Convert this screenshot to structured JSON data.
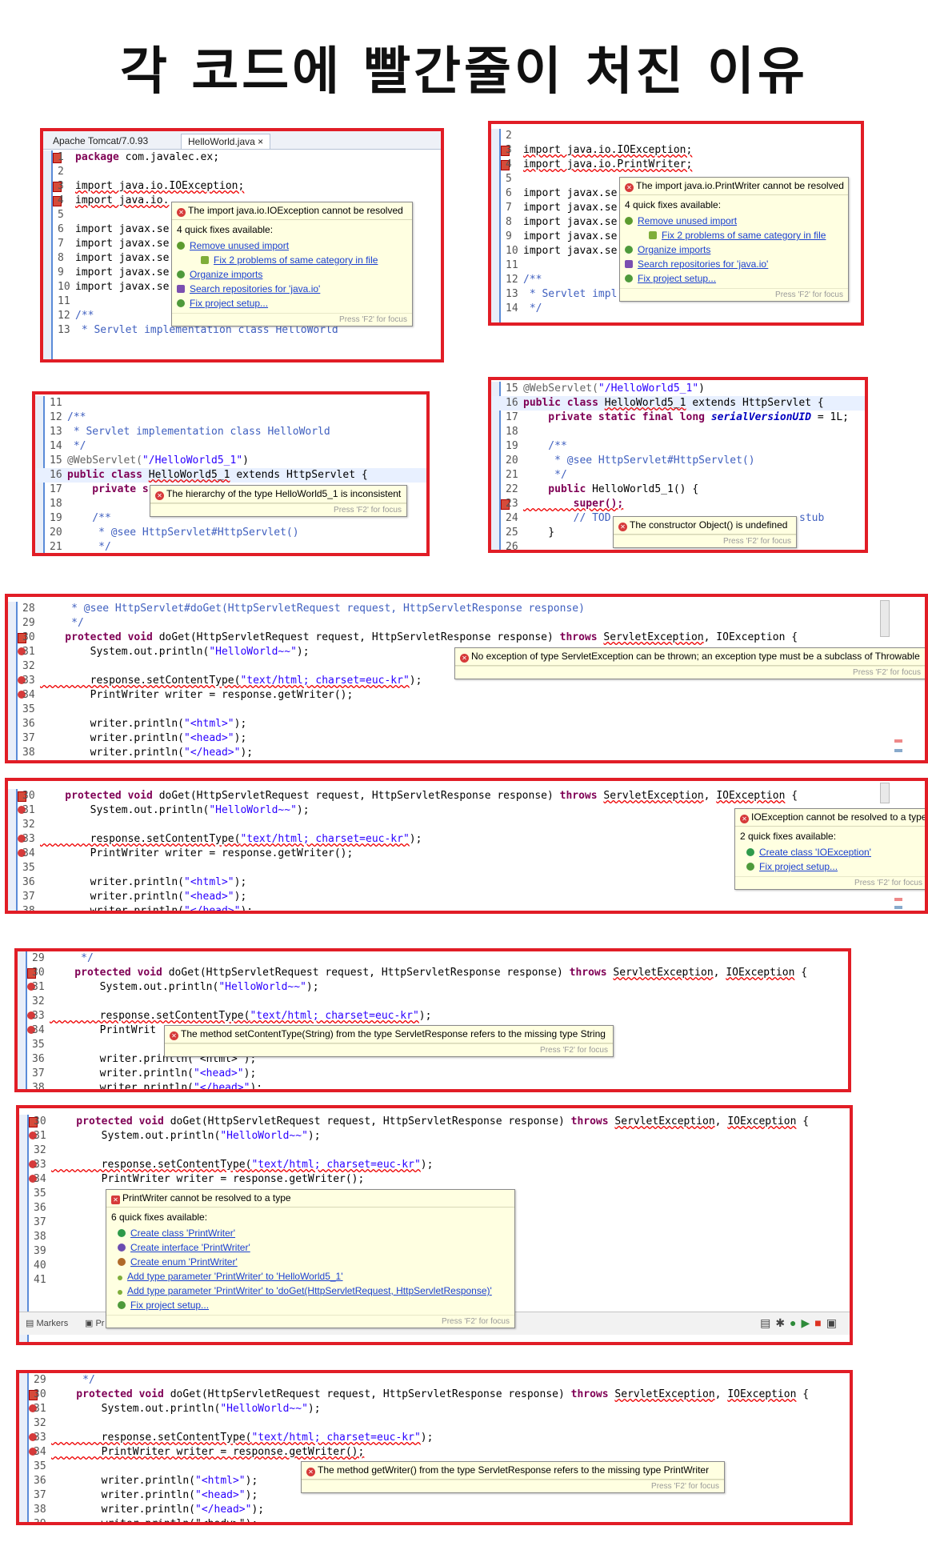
{
  "title": "각 코드에 빨간줄이 처진 이유",
  "colors": {
    "frame": "#e11d26",
    "keyword": "#7f0055",
    "string": "#2a00ff",
    "comment": "#3f5fbf",
    "link": "#1a3fd1",
    "tooltip_bg": "#ffffe1"
  },
  "p1": {
    "tabs": [
      "Apache Tomcat/7.0.93",
      "HelloWorld.java"
    ],
    "lines": {
      "l1n": "1",
      "l1": "package com.javalec.ex;",
      "l2n": "2",
      "l3n": "3",
      "l3": "import java.io.IOException;",
      "l4n": "4",
      "l4": "import java.io.",
      "l5n": "5",
      "l6n": "6",
      "l6": "import javax.se",
      "l7n": "7",
      "l7": "import javax.se",
      "l8n": "8",
      "l8": "import javax.se",
      "l9n": "9",
      "l9": "import javax.se",
      "l10n": "10",
      "l10": "import javax.se",
      "l11n": "11",
      "l12n": "12",
      "l12": "/**",
      "l13n": "13",
      "l13": " * Servlet implementation class HelloWorld"
    },
    "hover": {
      "message": "The import java.io.IOException cannot be resolved",
      "sub": "4 quick fixes available:",
      "fixes": [
        "Remove unused import",
        "Fix 2 problems of same category in file",
        "Organize imports",
        "Search repositories for 'java.io'",
        "Fix project setup..."
      ],
      "foot": "Press 'F2' for focus"
    }
  },
  "p2": {
    "lines": {
      "l2n": "2",
      "l3n": "3",
      "l3": "import java.io.IOException;",
      "l4n": "4",
      "l4": "import java.io.PrintWriter;",
      "l5n": "5",
      "l6n": "6",
      "l6": "import javax.se",
      "l7n": "7",
      "l7": "import javax.se",
      "l8n": "8",
      "l8": "import javax.se",
      "l9n": "9",
      "l9": "import javax.se",
      "l10n": "10",
      "l10": "import javax.se",
      "l11n": "11",
      "l12n": "12",
      "l12": "/**",
      "l13n": "13",
      "l13": " * Servlet impl",
      "l14n": "14",
      "l14": " */"
    },
    "hover": {
      "message": "The import java.io.PrintWriter cannot be resolved",
      "sub": "4 quick fixes available:",
      "fixes": [
        "Remove unused import",
        "Fix 2 problems of same category in file",
        "Organize imports",
        "Search repositories for 'java.io'",
        "Fix project setup..."
      ],
      "foot": "Press 'F2' for focus"
    }
  },
  "p3": {
    "lines": {
      "l11n": "11",
      "l12n": "12",
      "l12": "/**",
      "l13n": "13",
      "l13": " * Servlet implementation class HelloWorld",
      "l14n": "14",
      "l14": " */",
      "l15n": "15",
      "l15a": "@WebServlet(",
      "l15b": "\"/HelloWorld5_1\"",
      "l15c": ")",
      "l16n": "16",
      "l16a": "public class ",
      "l16b": "HelloWorld5_1",
      "l16c": " extends HttpServlet {",
      "l17n": "17",
      "l17": "    private s",
      "l18n": "18",
      "l19n": "19",
      "l19": "    /**",
      "l20n": "20",
      "l20": "     * @see HttpServlet#HttpServlet()",
      "l21n": "21",
      "l21": "     */"
    },
    "hover": {
      "message": "The hierarchy of the type HelloWorld5_1 is inconsistent",
      "foot": "Press 'F2' for focus"
    }
  },
  "p4": {
    "lines": {
      "l15n": "15",
      "l15a": "@WebServlet(",
      "l15b": "\"/HelloWorld5_1\"",
      "l15c": ")",
      "l16n": "16",
      "l16a": "public class ",
      "l16b": "HelloWorld5_1",
      "l16c": " extends HttpServlet {",
      "l17n": "17",
      "l17a": "    private static final long ",
      "l17b": "serialVersionUID",
      "l17c": " = 1L;",
      "l18n": "18",
      "l19n": "19",
      "l19": "    /**",
      "l20n": "20",
      "l20": "     * @see HttpServlet#HttpServlet()",
      "l21n": "21",
      "l21": "     */",
      "l22n": "22",
      "l22a": "    public ",
      "l22b": "HelloWorld5_1() {",
      "l23n": "23",
      "l23": "        super();",
      "l24n": "24",
      "l24": "        // TOD",
      "l24b": "stub",
      "l25n": "25",
      "l25": "    }",
      "l26n": "26"
    },
    "hover": {
      "message": "The constructor Object() is undefined",
      "foot": "Press 'F2' for focus"
    }
  },
  "p5": {
    "lines": {
      "l28n": "28",
      "l28": "     * @see HttpServlet#doGet(HttpServletRequest request, HttpServletResponse response)",
      "l29n": "29",
      "l29": "     */",
      "l30n": "30",
      "l30a": "    protected void ",
      "l30b": "doGet(HttpServletRequest request, HttpServletResponse response) ",
      "l30c": "throws ",
      "l30d": "ServletException",
      "l30e": ", IOException {",
      "l31n": "31",
      "l31a": "        System.out.println(",
      "l31b": "\"HelloWorld~~\"",
      "l31c": ");",
      "l32n": "32",
      "l33n": "33",
      "l33a": "        response.setContentType(",
      "l33b": "\"text/html; charset=euc-kr\"",
      "l33c": ");",
      "l34n": "34",
      "l34": "        PrintWriter writer = response.getWriter();",
      "l35n": "35",
      "l36n": "36",
      "l36a": "        writer.println(",
      "l36b": "\"<html>\"",
      "l36c": ");",
      "l37n": "37",
      "l37a": "        writer.println(",
      "l37b": "\"<head>\"",
      "l37c": ");",
      "l38n": "38",
      "l38a": "        writer.println(",
      "l38b": "\"</head>\"",
      "l38c": ");"
    },
    "hover": {
      "message": "No exception of type ServletException can be thrown; an exception type must be a subclass of Throwable",
      "foot": "Press 'F2' for focus"
    }
  },
  "p6": {
    "lines": {
      "l30n": "30",
      "l30a": "    protected void ",
      "l30b": "doGet(HttpServletRequest request, HttpServletResponse response) ",
      "l30c": "throws ",
      "l30d": "ServletException",
      "l30e": ", ",
      "l30f": "IOException",
      "l30g": " {",
      "l31n": "31",
      "l31a": "        System.out.println(",
      "l31b": "\"HelloWorld~~\"",
      "l31c": ");",
      "l32n": "32",
      "l33n": "33",
      "l33a": "        response.setContentType(",
      "l33b": "\"text/html; charset=euc-kr\"",
      "l33c": ");",
      "l34n": "34",
      "l34": "        PrintWriter writer = response.getWriter();",
      "l35n": "35",
      "l36n": "36",
      "l36a": "        writer.println(",
      "l36b": "\"<html>\"",
      "l36c": ");",
      "l37n": "37",
      "l37a": "        writer.println(",
      "l37b": "\"<head>\"",
      "l37c": ");",
      "l38n": "38",
      "l38a": "        writer.println(",
      "l38b": "\"</head>\"",
      "l38c": ");"
    },
    "hover": {
      "message": "IOException cannot be resolved to a type",
      "sub": "2 quick fixes available:",
      "fixes": [
        "Create class 'IOException'",
        "Fix project setup..."
      ],
      "foot": "Press 'F2' for focus"
    }
  },
  "p7": {
    "lines": {
      "l29n": "29",
      "l29": "     */",
      "l30n": "30",
      "l30a": "    protected void ",
      "l30b": "doGet(HttpServletRequest request, HttpServletResponse response) ",
      "l30c": "throws ",
      "l30d": "ServletException",
      "l30e": ", ",
      "l30f": "IOException",
      "l30g": " {",
      "l31n": "31",
      "l31a": "        System.out.println(",
      "l31b": "\"HelloWorld~~\"",
      "l31c": ");",
      "l32n": "32",
      "l33n": "33",
      "l33a": "        response.setContentType(",
      "l33b": "\"text/html; charset=euc-kr\"",
      "l33c": ");",
      "l34n": "34",
      "l34": "        PrintWrit",
      "l35n": "35",
      "l36n": "36",
      "l36": "        writer.println(\"<html>\");",
      "l37n": "37",
      "l37a": "        writer.println(",
      "l37b": "\"<head>\"",
      "l37c": ");",
      "l38n": "38",
      "l38a": "        writer.println(",
      "l38b": "\"</head>\"",
      "l38c": ");"
    },
    "hover": {
      "message": "The method setContentType(String) from the type ServletResponse refers to the missing type String",
      "foot": "Press 'F2' for focus"
    }
  },
  "p8": {
    "lines": {
      "l30n": "30",
      "l30a": "    protected void ",
      "l30b": "doGet(HttpServletRequest request, HttpServletResponse response) ",
      "l30c": "throws ",
      "l30d": "ServletException",
      "l30e": ", ",
      "l30f": "IOException",
      "l30g": " {",
      "l31n": "31",
      "l31a": "        System.out.println(",
      "l31b": "\"HelloWorld~~\"",
      "l31c": ");",
      "l32n": "32",
      "l33n": "33",
      "l33a": "        response.setContentType(",
      "l33b": "\"text/html; charset=euc-kr\"",
      "l33c": ");",
      "l34n": "34",
      "l34": "        PrintWriter writer = response.getWriter();",
      "l35n": "35",
      "l36n": "36",
      "l37n": "37",
      "l38n": "38",
      "l39n": "39",
      "l40n": "40",
      "l41n": "41"
    },
    "bottom": {
      "markers": "Markers",
      "problems": "Pr"
    },
    "hover": {
      "message": "PrintWriter cannot be resolved to a type",
      "sub": "6 quick fixes available:",
      "fixes": [
        "Create class 'PrintWriter'",
        "Create interface 'PrintWriter'",
        "Create enum 'PrintWriter'",
        "Add type parameter 'PrintWriter' to 'HelloWorld5_1'",
        "Add type parameter 'PrintWriter' to 'doGet(HttpServletRequest, HttpServletResponse)'",
        "Fix project setup..."
      ],
      "foot": "Press 'F2' for focus"
    }
  },
  "p9": {
    "lines": {
      "l29n": "29",
      "l29": "     */",
      "l30n": "30",
      "l30a": "    protected void ",
      "l30b": "doGet(HttpServletRequest request, HttpServletResponse response) ",
      "l30c": "throws ",
      "l30d": "ServletException",
      "l30e": ", ",
      "l30f": "IOException",
      "l30g": " {",
      "l31n": "31",
      "l31a": "        System.out.println(",
      "l31b": "\"HelloWorld~~\"",
      "l31c": ");",
      "l32n": "32",
      "l33n": "33",
      "l33a": "        response.setContentType(",
      "l33b": "\"text/html; charset=euc-kr\"",
      "l33c": ");",
      "l34n": "34",
      "l34": "        PrintWriter writer = response.getWriter();",
      "l35n": "35",
      "l36n": "36",
      "l36a": "        writer.println(",
      "l36b": "\"<html>\"",
      "l36c": ");",
      "l37n": "37",
      "l37a": "        writer.println(",
      "l37b": "\"<head>\"",
      "l37c": ");",
      "l38n": "38",
      "l38a": "        writer.println(",
      "l38b": "\"</head>\"",
      "l38c": ");",
      "l39n": "39",
      "l39": "        writer.println(\"<body>\");"
    },
    "hover": {
      "message": "The method getWriter() from the type ServletResponse refers to the missing type PrintWriter",
      "foot": "Press 'F2' for focus"
    }
  }
}
